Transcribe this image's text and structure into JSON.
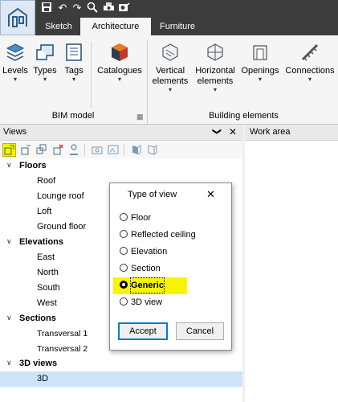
{
  "ribbon": {
    "tabs": [
      "Sketch",
      "Architecture",
      "Furniture"
    ],
    "active_tab": "Architecture",
    "bim_model": {
      "label": "BIM model",
      "buttons": [
        "Levels",
        "Types",
        "Tags",
        "Catalogues"
      ]
    },
    "building_elements": {
      "label": "Building elements",
      "buttons": [
        {
          "line1": "Vertical",
          "line2": "elements"
        },
        {
          "line1": "Horizontal",
          "line2": "elements"
        },
        {
          "line1": "Openings",
          "line2": ""
        },
        {
          "line1": "Connections",
          "line2": ""
        }
      ]
    }
  },
  "views_panel": {
    "title": "Views",
    "collapse_glyph": "❯",
    "close_glyph": "✕",
    "tree": {
      "floors": {
        "label": "Floors",
        "items": [
          "Roof",
          "Lounge roof",
          "Loft",
          "Ground floor"
        ]
      },
      "elevations": {
        "label": "Elevations",
        "items": [
          "East",
          "North",
          "South",
          "West"
        ]
      },
      "sections": {
        "label": "Sections",
        "items": [
          "Transversal 1",
          "Transversal 2"
        ]
      },
      "views3d": {
        "label": "3D views",
        "items": [
          "3D"
        ]
      }
    },
    "selected_item": "3D"
  },
  "work_area": {
    "title": "Work area"
  },
  "dialog": {
    "title": "Type of view",
    "close_glyph": "✕",
    "options": [
      "Floor",
      "Reflected ceiling",
      "Elevation",
      "Section",
      "Generic",
      "3D view"
    ],
    "selected": "Generic",
    "accept": "Accept",
    "cancel": "Cancel"
  },
  "colors": {
    "highlight": "#f7f500",
    "selection": "#cce4f7",
    "accent": "#0078d7"
  }
}
